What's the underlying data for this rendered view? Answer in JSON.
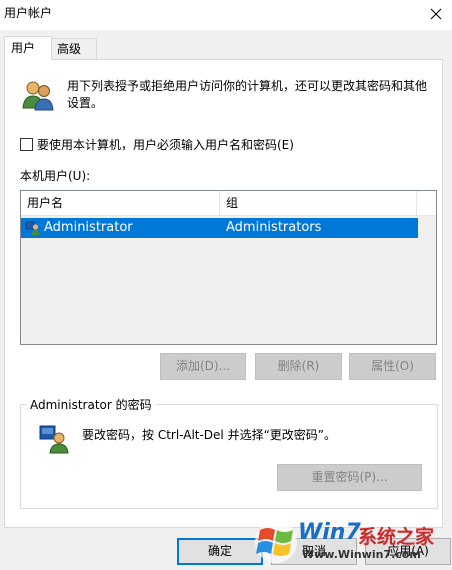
{
  "window": {
    "title": "用户帐户"
  },
  "tabs": [
    {
      "label": "用户"
    },
    {
      "label": "高级"
    }
  ],
  "info": {
    "text": "用下列表授予或拒绝用户访问你的计算机，还可以更改其密码和其他设置。"
  },
  "require_login": {
    "label": "要使用本计算机，用户必须输入用户名和密码(E)",
    "checked": false
  },
  "users": {
    "label": "本机用户(U):",
    "columns": [
      "用户名",
      "组"
    ],
    "rows": [
      {
        "name": "Administrator",
        "group": "Administrators"
      }
    ]
  },
  "buttons": {
    "add": "添加(D)...",
    "remove": "删除(R)",
    "properties": "属性(O)"
  },
  "password_group": {
    "title": "Administrator 的密码",
    "text": "要改密码，按 Ctrl-Alt-Del 并选择“更改密码”。",
    "reset": "重置密码(P)..."
  },
  "footer": {
    "ok": "确定",
    "cancel": "取消",
    "apply": "应用(A)"
  },
  "watermark": {
    "brand1": "Win7",
    "brand2": "系统之家",
    "url": "Www.Winwin7.com"
  },
  "colors": {
    "selection": "#0078d7",
    "disabled_button": "#cccccc"
  }
}
